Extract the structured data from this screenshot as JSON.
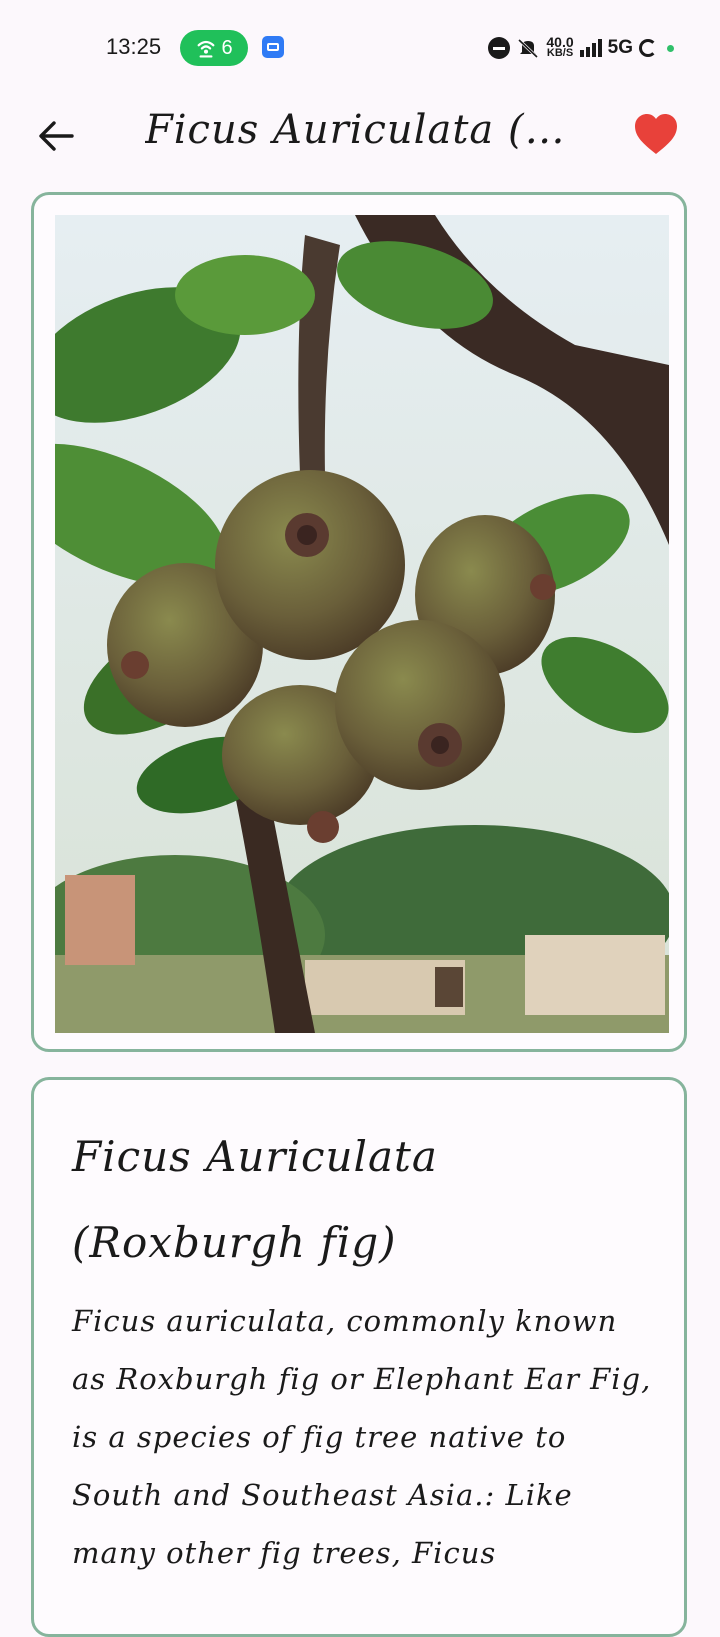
{
  "status_bar": {
    "time": "13:25",
    "hotspot_count": "6",
    "net_speed_value": "40.0",
    "net_speed_unit": "KB/S",
    "network": "5G"
  },
  "header": {
    "title": "Ficus Auriculata (Roxburgh fig)",
    "back_icon": "arrow-left-icon",
    "favorite_icon": "heart-icon",
    "favorite_color": "#e8413a"
  },
  "detail": {
    "name": "Ficus Auriculata (Roxburgh fig)",
    "description": "Ficus auriculata, commonly known as Roxburgh fig or Elephant Ear Fig, is a species of fig tree native to South and Southeast Asia.: Like many other fig trees, Ficus"
  },
  "colors": {
    "card_border": "#86b49c",
    "background": "#fcf8fc",
    "hotspot_green": "#20c05a"
  }
}
